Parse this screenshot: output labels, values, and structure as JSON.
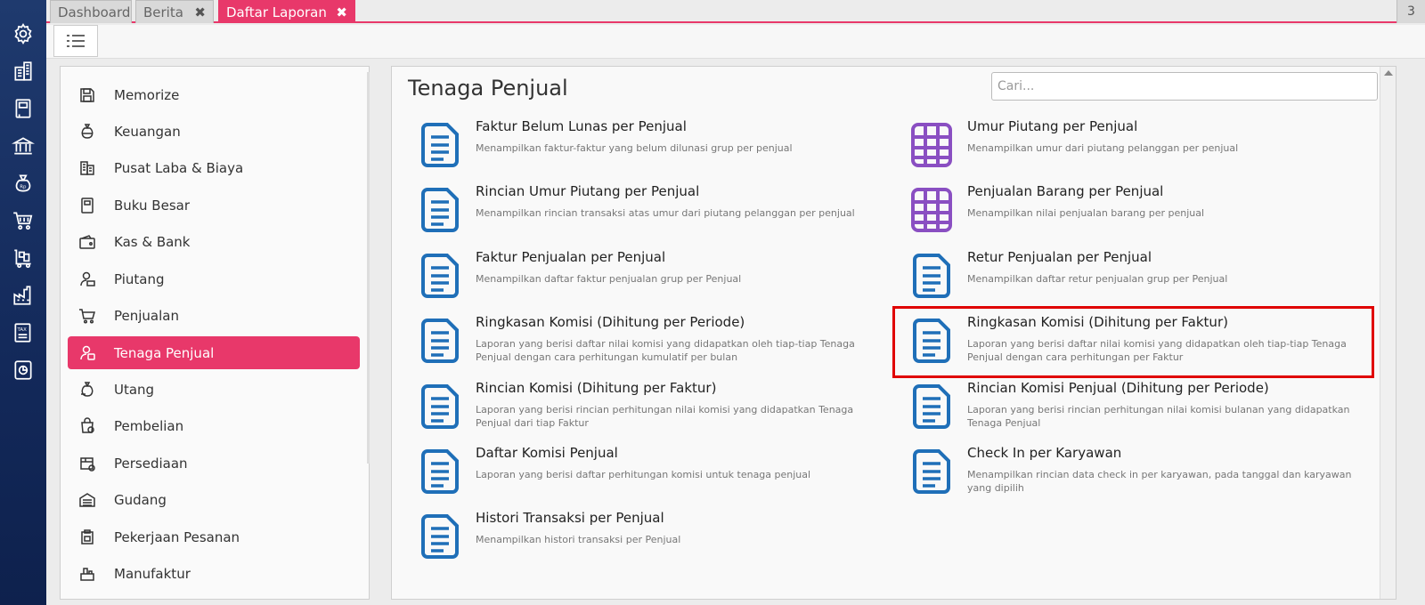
{
  "tabs": [
    {
      "label": "Dashboard",
      "closable": false,
      "active": false
    },
    {
      "label": "Berita",
      "closable": true,
      "active": false
    },
    {
      "label": "Daftar Laporan",
      "closable": true,
      "active": true
    }
  ],
  "tab_count": "3",
  "left_nav_icons": [
    "gear-icon",
    "building-icon",
    "book-icon",
    "bank-icon",
    "money-bag-icon",
    "cart-icon",
    "warehouse-cart-icon",
    "factory-icon",
    "tax-icon",
    "chart-doc-icon"
  ],
  "sidebar": {
    "items": [
      {
        "label": "Memorize",
        "icon": "save-icon"
      },
      {
        "label": "Keuangan",
        "icon": "money-bag-icon"
      },
      {
        "label": "Pusat Laba & Biaya",
        "icon": "building-icon"
      },
      {
        "label": "Buku Besar",
        "icon": "book-icon"
      },
      {
        "label": "Kas & Bank",
        "icon": "wallet-icon"
      },
      {
        "label": "Piutang",
        "icon": "receivable-icon"
      },
      {
        "label": "Penjualan",
        "icon": "cart-icon"
      },
      {
        "label": "Tenaga Penjual",
        "icon": "salesperson-icon",
        "active": true
      },
      {
        "label": "Utang",
        "icon": "debt-icon"
      },
      {
        "label": "Pembelian",
        "icon": "purchase-icon"
      },
      {
        "label": "Persediaan",
        "icon": "inventory-icon"
      },
      {
        "label": "Gudang",
        "icon": "warehouse-icon"
      },
      {
        "label": "Pekerjaan Pesanan",
        "icon": "job-order-icon"
      },
      {
        "label": "Manufaktur",
        "icon": "factory-icon"
      }
    ]
  },
  "main": {
    "title": "Tenaga Penjual",
    "search_placeholder": "Cari...",
    "reports": [
      {
        "title": "Faktur Belum Lunas per Penjual",
        "desc": "Menampilkan faktur-faktur yang belum dilunasi grup per penjual",
        "icon": "document-icon",
        "color": "#1f6fb8"
      },
      {
        "title": "Umur Piutang per Penjual",
        "desc": "Menampilkan umur dari piutang pelanggan per penjual",
        "icon": "table-icon",
        "color": "#8a4fc2"
      },
      {
        "title": "Rincian Umur Piutang per Penjual",
        "desc": "Menampilkan rincian transaksi atas umur dari piutang pelanggan per penjual",
        "icon": "document-icon",
        "color": "#1f6fb8"
      },
      {
        "title": "Penjualan Barang per Penjual",
        "desc": "Menampilkan nilai penjualan barang per penjual",
        "icon": "table-icon",
        "color": "#8a4fc2"
      },
      {
        "title": "Faktur Penjualan per Penjual",
        "desc": "Menampilkan daftar faktur penjualan grup per Penjual",
        "icon": "document-icon",
        "color": "#1f6fb8"
      },
      {
        "title": "Retur Penjualan per Penjual",
        "desc": "Menampilkan daftar retur penjualan grup per Penjual",
        "icon": "document-icon",
        "color": "#1f6fb8"
      },
      {
        "title": "Ringkasan Komisi (Dihitung per Periode)",
        "desc": "Laporan yang berisi daftar nilai komisi yang didapatkan oleh tiap-tiap Tenaga Penjual dengan cara perhitungan kumulatif per bulan",
        "icon": "document-icon",
        "color": "#1f6fb8"
      },
      {
        "title": "Ringkasan Komisi (Dihitung per Faktur)",
        "desc": "Laporan yang berisi daftar nilai komisi yang didapatkan oleh tiap-tiap Tenaga Penjual dengan cara perhitungan per Faktur",
        "icon": "document-icon",
        "color": "#1f6fb8",
        "highlighted": true
      },
      {
        "title": "Rincian Komisi (Dihitung per Faktur)",
        "desc": "Laporan yang berisi rincian perhitungan nilai komisi yang didapatkan Tenaga Penjual dari tiap Faktur",
        "icon": "document-icon",
        "color": "#1f6fb8"
      },
      {
        "title": "Rincian Komisi Penjual (Dihitung per Periode)",
        "desc": "Laporan yang berisi rincian perhitungan nilai komisi bulanan yang didapatkan Tenaga Penjual",
        "icon": "document-icon",
        "color": "#1f6fb8"
      },
      {
        "title": "Daftar Komisi Penjual",
        "desc": "Laporan yang berisi daftar perhitungan komisi untuk tenaga penjual",
        "icon": "document-icon",
        "color": "#1f6fb8"
      },
      {
        "title": "Check In per Karyawan",
        "desc": "Menampilkan rincian data check in per karyawan, pada tanggal dan karyawan yang dipilih",
        "icon": "document-icon",
        "color": "#1f6fb8"
      },
      {
        "title": "Histori Transaksi per Penjual",
        "desc": "Menampilkan histori transaksi per Penjual",
        "icon": "document-icon",
        "color": "#1f6fb8"
      }
    ]
  },
  "colors": {
    "accent": "#e8386a",
    "doc_icon": "#1f6fb8",
    "table_icon": "#8a4fc2",
    "highlight": "#e00000"
  }
}
